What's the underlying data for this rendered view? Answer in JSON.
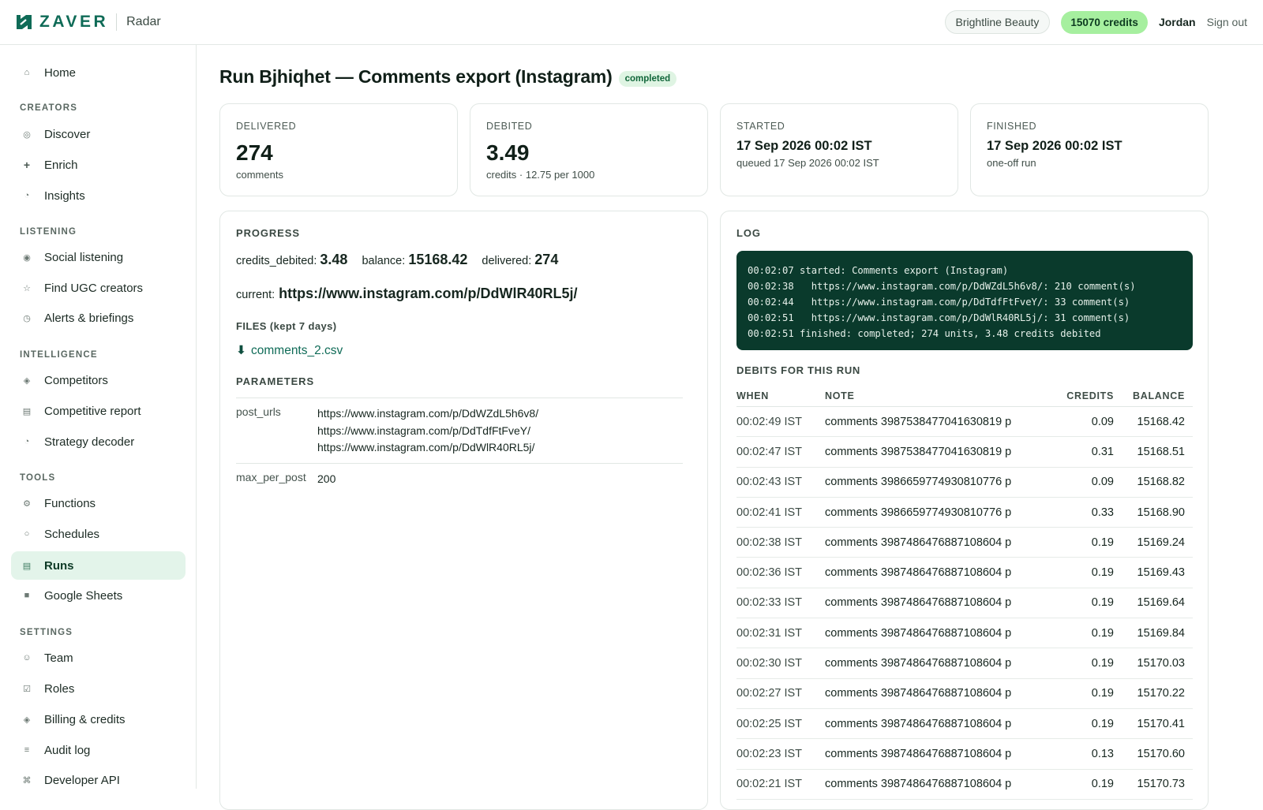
{
  "header": {
    "brand": "ZAVER",
    "app": "Radar",
    "org": "Brightline Beauty",
    "credits": "15070 credits",
    "user": "Jordan",
    "signout": "Sign out"
  },
  "sidebar": {
    "home": "Home",
    "sections": [
      {
        "title": "CREATORS",
        "items": [
          {
            "label": "Discover",
            "icon": "compass-icon"
          },
          {
            "label": "Enrich",
            "icon": "plus-icon"
          },
          {
            "label": "Insights",
            "icon": "pie-icon"
          }
        ]
      },
      {
        "title": "LISTENING",
        "items": [
          {
            "label": "Social listening",
            "icon": "radio-icon"
          },
          {
            "label": "Find UGC creators",
            "icon": "star-icon"
          },
          {
            "label": "Alerts & briefings",
            "icon": "clock-icon"
          }
        ]
      },
      {
        "title": "INTELLIGENCE",
        "items": [
          {
            "label": "Competitors",
            "icon": "diamond-icon"
          },
          {
            "label": "Competitive report",
            "icon": "report-icon"
          },
          {
            "label": "Strategy decoder",
            "icon": "pie-icon"
          }
        ]
      },
      {
        "title": "TOOLS",
        "items": [
          {
            "label": "Functions",
            "icon": "gear-icon"
          },
          {
            "label": "Schedules",
            "icon": "circle-icon"
          },
          {
            "label": "Runs",
            "icon": "list-icon",
            "active": true
          },
          {
            "label": "Google Sheets",
            "icon": "sheet-icon"
          }
        ]
      },
      {
        "title": "SETTINGS",
        "items": [
          {
            "label": "Team",
            "icon": "smile-icon"
          },
          {
            "label": "Roles",
            "icon": "check-box-icon"
          },
          {
            "label": "Billing & credits",
            "icon": "diamond-icon"
          },
          {
            "label": "Audit log",
            "icon": "lines-icon"
          },
          {
            "label": "Developer API",
            "icon": "command-icon"
          }
        ]
      }
    ]
  },
  "page": {
    "title": "Run Bjhiqhet — Comments export (Instagram)",
    "status": "completed"
  },
  "stats": {
    "delivered": {
      "label": "DELIVERED",
      "value": "274",
      "sub": "comments"
    },
    "debited": {
      "label": "DEBITED",
      "value": "3.49",
      "sub": "credits · 12.75 per 1000"
    },
    "started": {
      "label": "STARTED",
      "value": "17 Sep 2026 00:02 IST",
      "sub": "queued 17 Sep 2026 00:02 IST"
    },
    "finished": {
      "label": "FINISHED",
      "value": "17 Sep 2026 00:02 IST",
      "sub": "one-off run"
    }
  },
  "progress": {
    "heading": "PROGRESS",
    "credits_label": "credits_debited:",
    "credits_value": "3.48",
    "balance_label": "balance:",
    "balance_value": "15168.42",
    "delivered_label": "delivered:",
    "delivered_value": "274",
    "current_label": "current:",
    "current_value": "https://www.instagram.com/p/DdWlR40RL5j/",
    "files_heading": "FILES (kept 7 days)",
    "file_name": "comments_2.csv",
    "params_heading": "PARAMETERS",
    "params": [
      {
        "key": "post_urls",
        "values": [
          "https://www.instagram.com/p/DdWZdL5h6v8/",
          "https://www.instagram.com/p/DdTdfFtFveY/",
          "https://www.instagram.com/p/DdWlR40RL5j/"
        ]
      },
      {
        "key": "max_per_post",
        "values": [
          "200"
        ]
      }
    ]
  },
  "log": {
    "heading": "LOG",
    "lines": [
      "00:02:07 started: Comments export (Instagram)",
      "00:02:38   https://www.instagram.com/p/DdWZdL5h6v8/: 210 comment(s)",
      "00:02:44   https://www.instagram.com/p/DdTdfFtFveY/: 33 comment(s)",
      "00:02:51   https://www.instagram.com/p/DdWlR40RL5j/: 31 comment(s)",
      "00:02:51 finished: completed; 274 units, 3.48 credits debited"
    ]
  },
  "debits": {
    "heading": "DEBITS FOR THIS RUN",
    "columns": {
      "when": "WHEN",
      "note": "NOTE",
      "credits": "CREDITS",
      "balance": "BALANCE"
    },
    "rows": [
      {
        "when": "00:02:49 IST",
        "note": "comments 3987538477041630819 p",
        "credits": "0.09",
        "balance": "15168.42"
      },
      {
        "when": "00:02:47 IST",
        "note": "comments 3987538477041630819 p",
        "credits": "0.31",
        "balance": "15168.51"
      },
      {
        "when": "00:02:43 IST",
        "note": "comments 3986659774930810776 p",
        "credits": "0.09",
        "balance": "15168.82"
      },
      {
        "when": "00:02:41 IST",
        "note": "comments 3986659774930810776 p",
        "credits": "0.33",
        "balance": "15168.90"
      },
      {
        "when": "00:02:38 IST",
        "note": "comments 3987486476887108604 p",
        "credits": "0.19",
        "balance": "15169.24"
      },
      {
        "when": "00:02:36 IST",
        "note": "comments 3987486476887108604 p",
        "credits": "0.19",
        "balance": "15169.43"
      },
      {
        "when": "00:02:33 IST",
        "note": "comments 3987486476887108604 p",
        "credits": "0.19",
        "balance": "15169.64"
      },
      {
        "when": "00:02:31 IST",
        "note": "comments 3987486476887108604 p",
        "credits": "0.19",
        "balance": "15169.84"
      },
      {
        "when": "00:02:30 IST",
        "note": "comments 3987486476887108604 p",
        "credits": "0.19",
        "balance": "15170.03"
      },
      {
        "when": "00:02:27 IST",
        "note": "comments 3987486476887108604 p",
        "credits": "0.19",
        "balance": "15170.22"
      },
      {
        "when": "00:02:25 IST",
        "note": "comments 3987486476887108604 p",
        "credits": "0.19",
        "balance": "15170.41"
      },
      {
        "when": "00:02:23 IST",
        "note": "comments 3987486476887108604 p",
        "credits": "0.13",
        "balance": "15170.60"
      },
      {
        "when": "00:02:21 IST",
        "note": "comments 3987486476887108604 p",
        "credits": "0.19",
        "balance": "15170.73"
      }
    ]
  }
}
